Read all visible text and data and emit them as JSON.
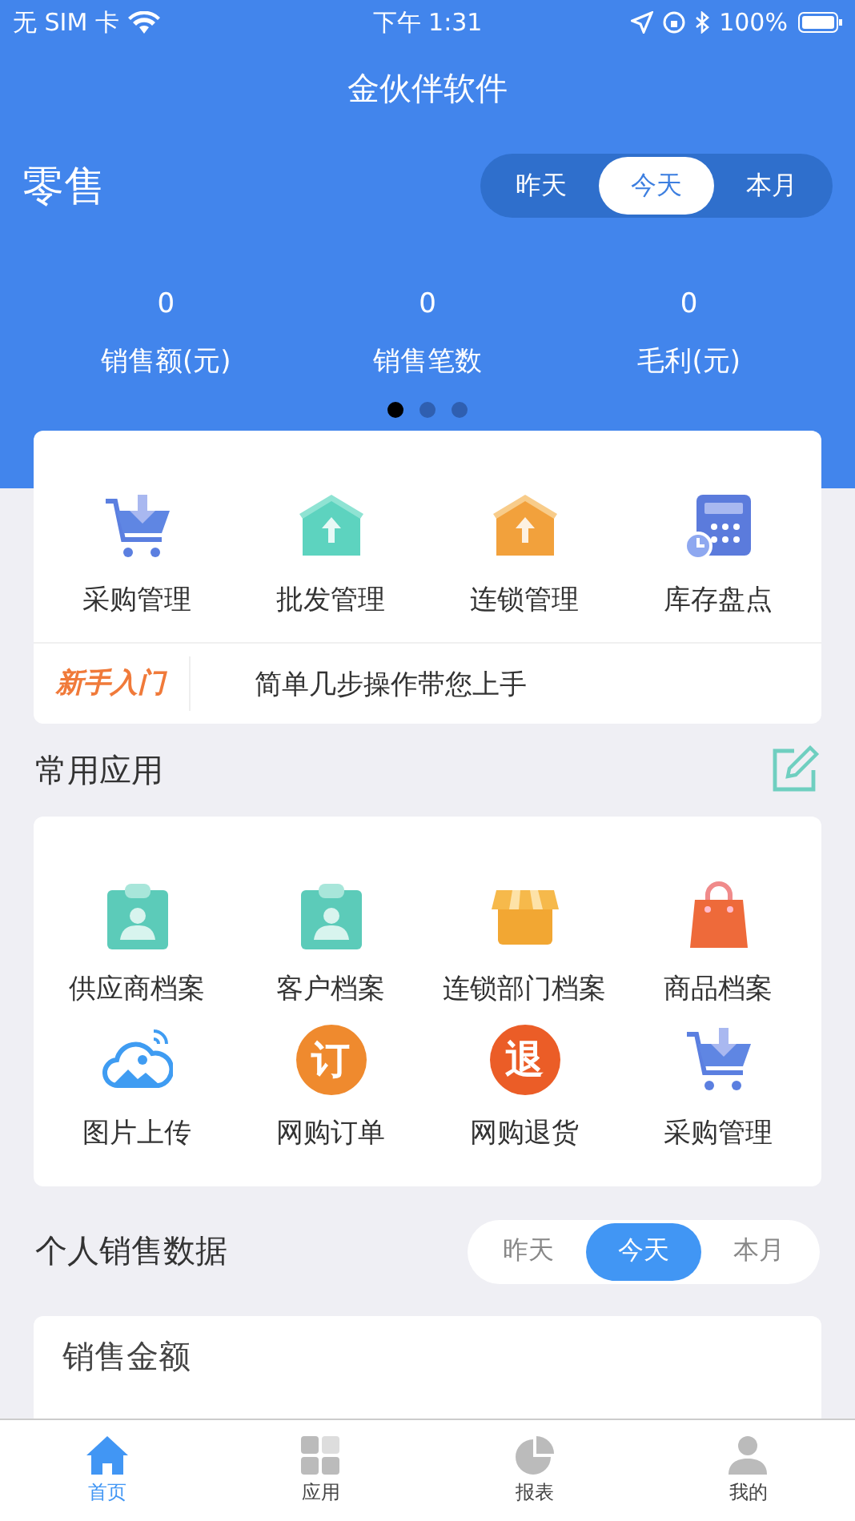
{
  "status_bar": {
    "carrier": "无 SIM 卡",
    "time": "下午 1:31",
    "battery": "100%"
  },
  "title": "金伙伴软件",
  "retail": {
    "title": "零售",
    "periods": [
      {
        "label": "昨天",
        "selected": false
      },
      {
        "label": "今天",
        "selected": true
      },
      {
        "label": "本月",
        "selected": false
      }
    ],
    "stats": [
      {
        "value": "0",
        "label": "销售额(元)"
      },
      {
        "value": "0",
        "label": "销售笔数"
      },
      {
        "value": "0",
        "label": "毛利(元)"
      }
    ],
    "pages": [
      {
        "selected": true
      },
      {
        "selected": false
      },
      {
        "selected": false
      }
    ]
  },
  "modules": [
    {
      "label": "采购管理",
      "kind": "cart"
    },
    {
      "label": "批发管理",
      "kind": "house-teal"
    },
    {
      "label": "连锁管理",
      "kind": "house-orange"
    },
    {
      "label": "库存盘点",
      "kind": "calculator"
    }
  ],
  "guide": {
    "badge": "新手入门",
    "text": "简单几步操作带您上手"
  },
  "common_apps": {
    "title": "常用应用",
    "apps": [
      {
        "label": "供应商档案",
        "kind": "clipboard"
      },
      {
        "label": "客户档案",
        "kind": "clipboard"
      },
      {
        "label": "连锁部门档案",
        "kind": "store"
      },
      {
        "label": "商品档案",
        "kind": "bag"
      },
      {
        "label": "图片上传",
        "kind": "cloud"
      },
      {
        "label": "网购订单",
        "kind": "glyph",
        "glyph": "订",
        "color": "#ef8a2e"
      },
      {
        "label": "网购退货",
        "kind": "glyph",
        "glyph": "退",
        "color": "#eb5d27"
      },
      {
        "label": "采购管理",
        "kind": "cart"
      }
    ]
  },
  "personal_sales": {
    "title": "个人销售数据",
    "periods": [
      {
        "label": "昨天",
        "selected": false
      },
      {
        "label": "今天",
        "selected": true
      },
      {
        "label": "本月",
        "selected": false
      }
    ],
    "card_title": "销售金额"
  },
  "tab_bar": [
    {
      "label": "首页",
      "kind": "home",
      "selected": true
    },
    {
      "label": "应用",
      "kind": "apps",
      "selected": false
    },
    {
      "label": "报表",
      "kind": "report",
      "selected": false
    },
    {
      "label": "我的",
      "kind": "profile",
      "selected": false
    }
  ]
}
